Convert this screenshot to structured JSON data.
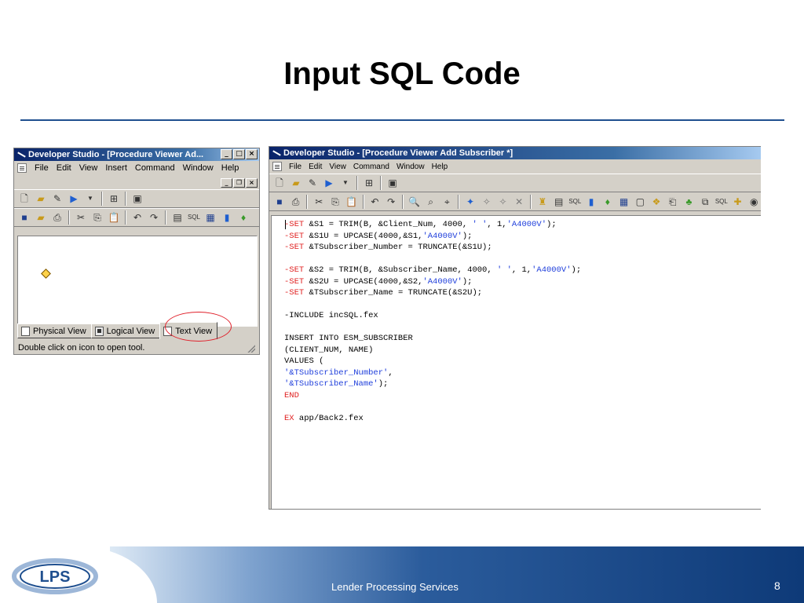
{
  "slide": {
    "title": "Input SQL Code",
    "footer": "Lender Processing Services",
    "page": "8"
  },
  "logo": {
    "text": "LPS"
  },
  "left_window": {
    "title": "Developer Studio - [Procedure Viewer Ad...",
    "menu": [
      "File",
      "Edit",
      "View",
      "Insert",
      "Command",
      "Window",
      "Help"
    ],
    "tabs": [
      "Physical View",
      "Logical View",
      "Text View"
    ],
    "status": "Double click on icon to open tool."
  },
  "right_window": {
    "title": "Developer Studio - [Procedure Viewer Add Subscriber *]",
    "menu": [
      "File",
      "Edit",
      "View",
      "Command",
      "Window",
      "Help"
    ]
  },
  "code_lines": [
    [
      [
        "kw",
        "-SET"
      ],
      [
        "t",
        " &S1 = TRIM(B, &Client_Num, 4000, "
      ],
      [
        "str",
        "' '"
      ],
      [
        "t",
        ", 1,"
      ],
      [
        "str",
        "'A4000V'"
      ],
      [
        "t",
        ");"
      ]
    ],
    [
      [
        "kw",
        "-SET"
      ],
      [
        "t",
        " &S1U = UPCASE(4000,&S1,"
      ],
      [
        "str",
        "'A4000V'"
      ],
      [
        "t",
        ");"
      ]
    ],
    [
      [
        "kw",
        "-SET"
      ],
      [
        "t",
        " &TSubscriber_Number = TRUNCATE(&S1U);"
      ]
    ],
    [
      [
        "t",
        ""
      ]
    ],
    [
      [
        "kw",
        "-SET"
      ],
      [
        "t",
        " &S2 = TRIM(B, &Subscriber_Name, 4000, "
      ],
      [
        "str",
        "' '"
      ],
      [
        "t",
        ", 1,"
      ],
      [
        "str",
        "'A4000V'"
      ],
      [
        "t",
        ");"
      ]
    ],
    [
      [
        "kw",
        "-SET"
      ],
      [
        "t",
        " &S2U = UPCASE(4000,&S2,"
      ],
      [
        "str",
        "'A4000V'"
      ],
      [
        "t",
        ");"
      ]
    ],
    [
      [
        "kw",
        "-SET"
      ],
      [
        "t",
        " &TSubscriber_Name = TRUNCATE(&S2U);"
      ]
    ],
    [
      [
        "t",
        ""
      ]
    ],
    [
      [
        "t",
        "-INCLUDE incSQL.fex"
      ]
    ],
    [
      [
        "t",
        ""
      ]
    ],
    [
      [
        "t",
        "INSERT INTO ESM_SUBSCRIBER"
      ]
    ],
    [
      [
        "t",
        "(CLIENT_NUM, NAME)"
      ]
    ],
    [
      [
        "t",
        "VALUES ("
      ]
    ],
    [
      [
        "str",
        "'&TSubscriber_Number'"
      ],
      [
        "t",
        ","
      ]
    ],
    [
      [
        "str",
        "'&TSubscriber_Name'"
      ],
      [
        "t",
        ");"
      ]
    ],
    [
      [
        "kw",
        "END"
      ]
    ],
    [
      [
        "t",
        ""
      ]
    ],
    [
      [
        "kw",
        "EX"
      ],
      [
        "t",
        " app/Back2.fex"
      ]
    ]
  ]
}
